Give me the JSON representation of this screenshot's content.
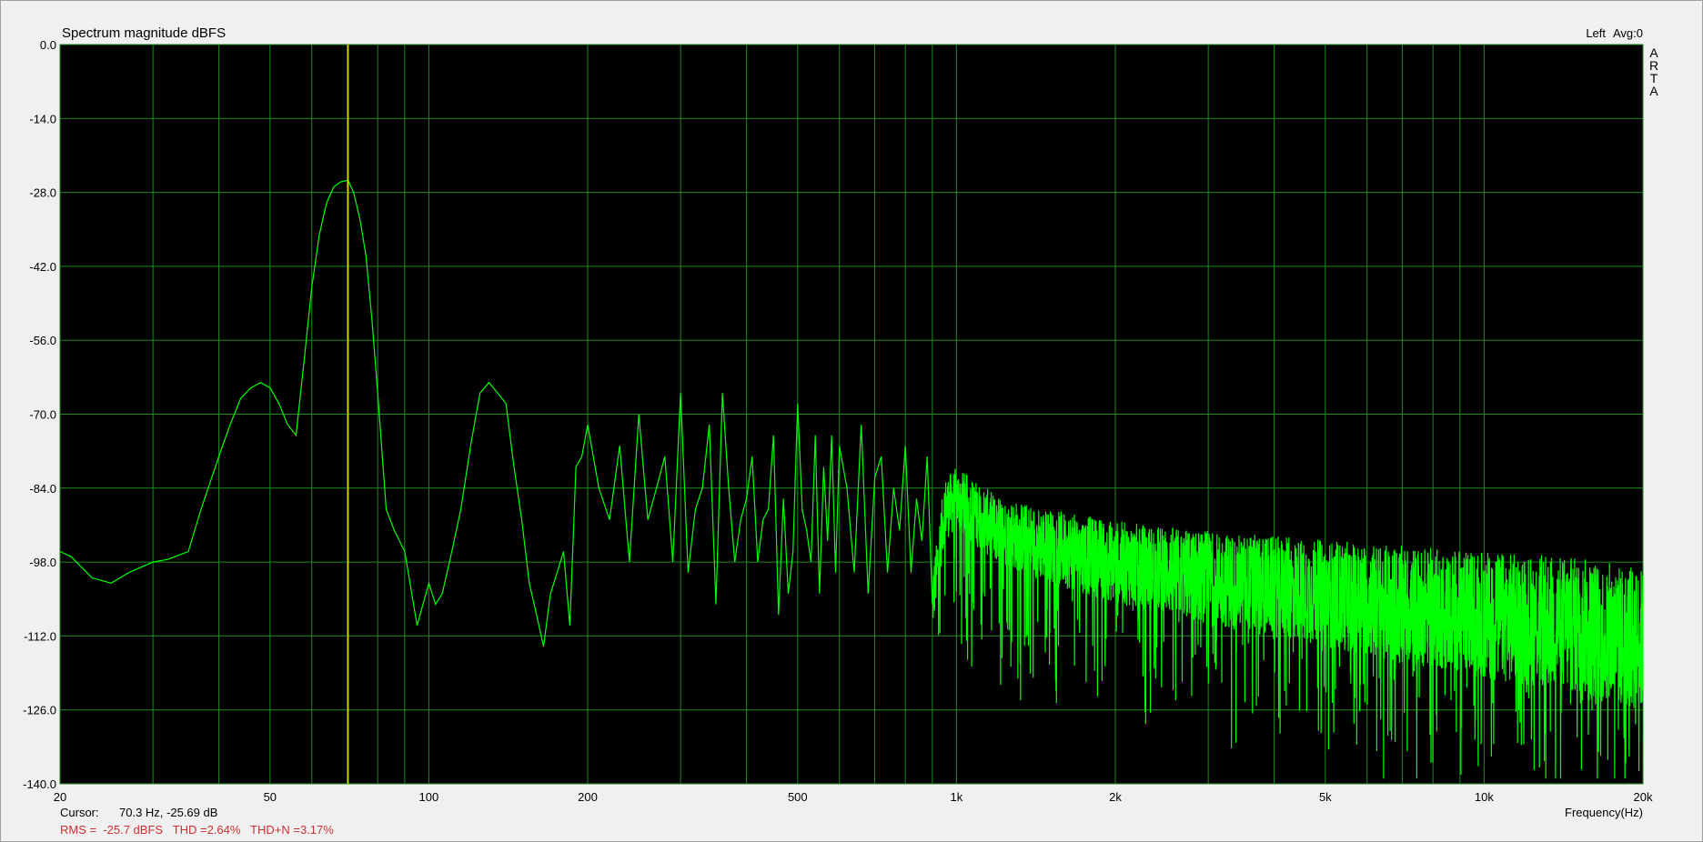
{
  "chart_data": {
    "type": "line",
    "title": "Spectrum magnitude dBFS",
    "channel_label": "Left",
    "avg_label": "Avg:0",
    "brand_letters": [
      "A",
      "R",
      "T",
      "A"
    ],
    "xlabel": "Frequency(Hz)",
    "xscale": "log",
    "xlim": [
      20,
      20000
    ],
    "ylim": [
      -140,
      0
    ],
    "grid": true,
    "x_ticks": [
      {
        "value": 20,
        "label": "20"
      },
      {
        "value": 50,
        "label": "50"
      },
      {
        "value": 100,
        "label": "100"
      },
      {
        "value": 200,
        "label": "200"
      },
      {
        "value": 500,
        "label": "500"
      },
      {
        "value": 1000,
        "label": "1k"
      },
      {
        "value": 2000,
        "label": "2k"
      },
      {
        "value": 5000,
        "label": "5k"
      },
      {
        "value": 10000,
        "label": "10k"
      },
      {
        "value": 20000,
        "label": "20k"
      }
    ],
    "y_ticks": [
      {
        "value": 0,
        "label": "0.0"
      },
      {
        "value": -14,
        "label": "-14.0"
      },
      {
        "value": -28,
        "label": "-28.0"
      },
      {
        "value": -42,
        "label": "-42.0"
      },
      {
        "value": -56,
        "label": "-56.0"
      },
      {
        "value": -70,
        "label": "-70.0"
      },
      {
        "value": -84,
        "label": "-84.0"
      },
      {
        "value": -98,
        "label": "-98.0"
      },
      {
        "value": -112,
        "label": "-112.0"
      },
      {
        "value": -126,
        "label": "-126.0"
      },
      {
        "value": -140,
        "label": "-140.0"
      }
    ],
    "cursor": {
      "frequency_hz": 70.3,
      "label": "Cursor:",
      "readout": "70.3 Hz, -25.69 dB"
    },
    "stats_text": "RMS =  -25.7 dBFS   THD =2.64%   THD+N =3.17%",
    "series": [
      {
        "x": [
          20,
          21,
          23,
          25,
          27,
          30,
          32,
          35,
          37,
          40,
          42,
          44,
          46,
          48,
          50,
          52,
          54,
          56,
          58,
          60,
          62,
          64,
          66,
          68,
          70.3,
          72,
          74,
          76,
          78,
          80,
          83,
          86,
          90,
          95,
          100,
          103,
          106,
          110,
          115,
          120,
          125,
          130,
          135,
          140,
          145,
          150,
          155,
          160,
          165,
          170,
          175,
          180,
          185,
          190,
          195,
          200,
          210,
          220,
          230,
          240,
          250,
          260,
          270,
          280,
          290,
          300,
          310,
          320,
          330,
          340,
          350,
          360,
          370,
          380,
          390,
          400,
          410,
          420,
          430,
          440,
          450,
          460,
          470,
          480,
          490,
          500,
          510,
          520,
          530,
          540,
          550,
          560,
          570,
          580,
          590,
          600,
          620,
          640,
          660,
          680,
          700,
          720,
          740,
          760,
          780,
          800,
          820,
          840,
          860,
          880,
          900,
          950,
          1000,
          1200,
          1500,
          2000,
          3000,
          5000,
          7000,
          10000,
          15000,
          20000
        ],
        "values": [
          -96,
          -97,
          -101,
          -102,
          -100,
          -98,
          -97.5,
          -96,
          -88,
          -78,
          -72,
          -67,
          -65,
          -64,
          -65,
          -68,
          -72,
          -74,
          -60,
          -46,
          -36,
          -30,
          -27,
          -26,
          -25.7,
          -28,
          -33,
          -40,
          -52,
          -66,
          -88,
          -92,
          -96,
          -110,
          -102,
          -106,
          -104,
          -97,
          -88,
          -76,
          -66,
          -64,
          -66,
          -68,
          -80,
          -90,
          -102,
          -108,
          -114,
          -104,
          -100,
          -96,
          -110,
          -80,
          -78,
          -72,
          -84,
          -90,
          -76,
          -98,
          -70,
          -90,
          -84,
          -78,
          -98,
          -66,
          -100,
          -88,
          -84,
          -72,
          -106,
          -66,
          -84,
          -98,
          -90,
          -86,
          -78,
          -98,
          -90,
          -88,
          -74,
          -108,
          -86,
          -104,
          -96,
          -68,
          -88,
          -92,
          -98,
          -74,
          -104,
          -80,
          -94,
          -74,
          -100,
          -76,
          -84,
          -100,
          -72,
          -104,
          -82,
          -78,
          -100,
          -84,
          -92,
          -76,
          -100,
          -86,
          -94,
          -78,
          -106,
          -88,
          -86,
          -92,
          -95,
          -98,
          -101,
          -104,
          -106,
          -108,
          -110,
          -113
        ]
      }
    ],
    "colors": {
      "plot_bg": "#000000",
      "grid": "#1f8a1f",
      "trace": "#00ff00",
      "cursor_line": "#d4d400",
      "stats_text": "#c83232",
      "frame_bg": "#f0f0f0"
    }
  }
}
